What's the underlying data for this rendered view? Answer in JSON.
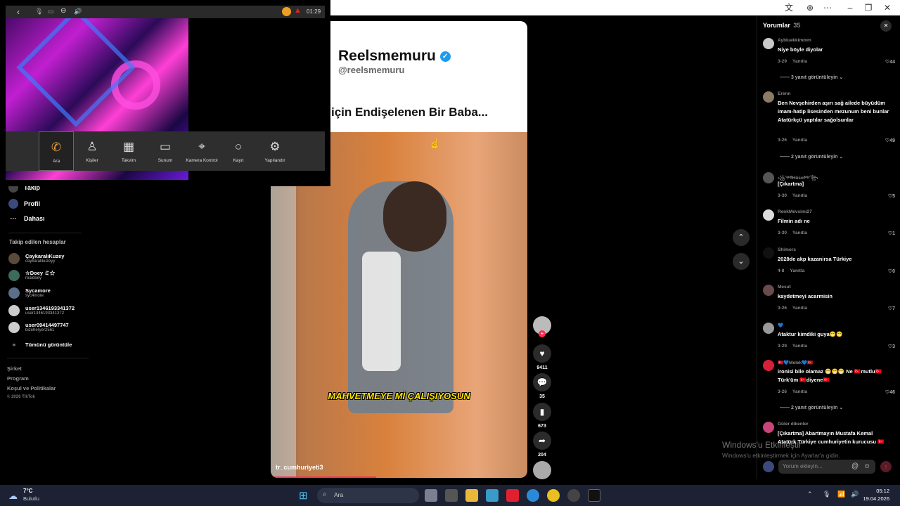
{
  "overlay": {
    "clock": "01:29",
    "buttons": [
      {
        "label": "Ara",
        "icon": "phone-icon"
      },
      {
        "label": "Kişiler",
        "icon": "person-icon"
      },
      {
        "label": "Takvim",
        "icon": "calendar-icon"
      },
      {
        "label": "Sunum",
        "icon": "presentation-icon"
      },
      {
        "label": "Kamera Kontrol",
        "icon": "camera-control-icon"
      },
      {
        "label": "Kayıt",
        "icon": "record-icon"
      },
      {
        "label": "Yapılandır",
        "icon": "settings-icon"
      }
    ]
  },
  "sidebar": {
    "partial_item": "Takip",
    "profile": "Profil",
    "more": "Dahası",
    "following_title": "Takip edilen hesaplar",
    "following": [
      {
        "name": "ÇaykaralıKuzey",
        "handle": "caykaralikuzeyy"
      },
      {
        "name": "☆Doey ミ☆",
        "handle": "realdoey"
      },
      {
        "name": "Sycamore",
        "handle": "syc4more"
      },
      {
        "name": "user1346193341372",
        "handle": "user1346193341372"
      },
      {
        "name": "user09414497747",
        "handle": "bizeheryer2561"
      }
    ],
    "see_all": "Tümünü görüntüle",
    "footer": [
      "Şirket",
      "Program",
      "Koşul ve Politikalar"
    ],
    "copyright": "© 2026 TikTok"
  },
  "video": {
    "account_name": "Reelsmemuru",
    "account_handle": "@reelsmemuru",
    "headline": "için Endişelenen Bir Baba...",
    "caption": "MAHVETMEYE Mİ ÇALIŞIYOSUN",
    "uploader": "tr_cumhuriyeti3",
    "likes": "9411",
    "comments": "35",
    "saves": "673",
    "shares": "204"
  },
  "comments": {
    "title": "Yorumlar",
    "count": "35",
    "reply_label": "Yanıtla",
    "items": [
      {
        "user": "Aybluekkimmm",
        "text": "Niye böyle diyolar",
        "date": "3-29",
        "likes": "44",
        "more": "3 yanıt görüntüleyin"
      },
      {
        "user": "Erenn",
        "text": "Ben Nevşehirden aşırı sağ ailede büyüdüm imam-hatip lisesinden mezunum beni bunlar Atatürkçü yaptılar sağolsunlar",
        "date": "3-26",
        "likes": "49",
        "more": "2 yanıt görüntüleyin"
      },
      {
        "user": "꧁༺Hüso༻꧂",
        "text": "[Çıkartma]",
        "date": "3-30",
        "likes": "5",
        "more": ""
      },
      {
        "user": "RenkMevsimi27",
        "text": "Filmin adı ne",
        "date": "3-30",
        "likes": "1",
        "more": ""
      },
      {
        "user": "Shimors",
        "text": "2028de akp kazanirsa Türkiye",
        "date": "4-8",
        "likes": "0",
        "more": ""
      },
      {
        "user": "Mesut",
        "text": "kaydetmeyi acarmisin",
        "date": "3-26",
        "likes": "7",
        "more": ""
      },
      {
        "user": "💙",
        "text": "Ataktur kimdiki guya😁😁",
        "date": "3-29",
        "likes": "3",
        "more": ""
      },
      {
        "user": "🇹🇷💙Melek💙🇹🇷",
        "text": "ironisi bile olamaz 😁😁😁 Ne 🇹🇷mutlu🇹🇷 Türk'üm 🇹🇷diyene🇹🇷",
        "date": "3-26",
        "likes": "46",
        "more": "2 yanıt görüntüleyin"
      },
      {
        "user": "Güler dikenler",
        "text": "[Çıkartma] Abartmayın Mustafa Kemal Atatürk Türkiye cumhuriyetin kurucusu 🇹🇷",
        "date": "",
        "likes": "",
        "more": ""
      }
    ],
    "input_placeholder": "Yorum ekleyin..."
  },
  "watermark": {
    "line1": "Windows'u Etkinleştir",
    "line2": "Windows'u etkinleştirmek için Ayarlar'a gidin."
  },
  "taskbar": {
    "temp": "7°C",
    "weather": "Bulutlu",
    "search_placeholder": "Ara",
    "time": "05:12",
    "date": "19.04.2026"
  }
}
